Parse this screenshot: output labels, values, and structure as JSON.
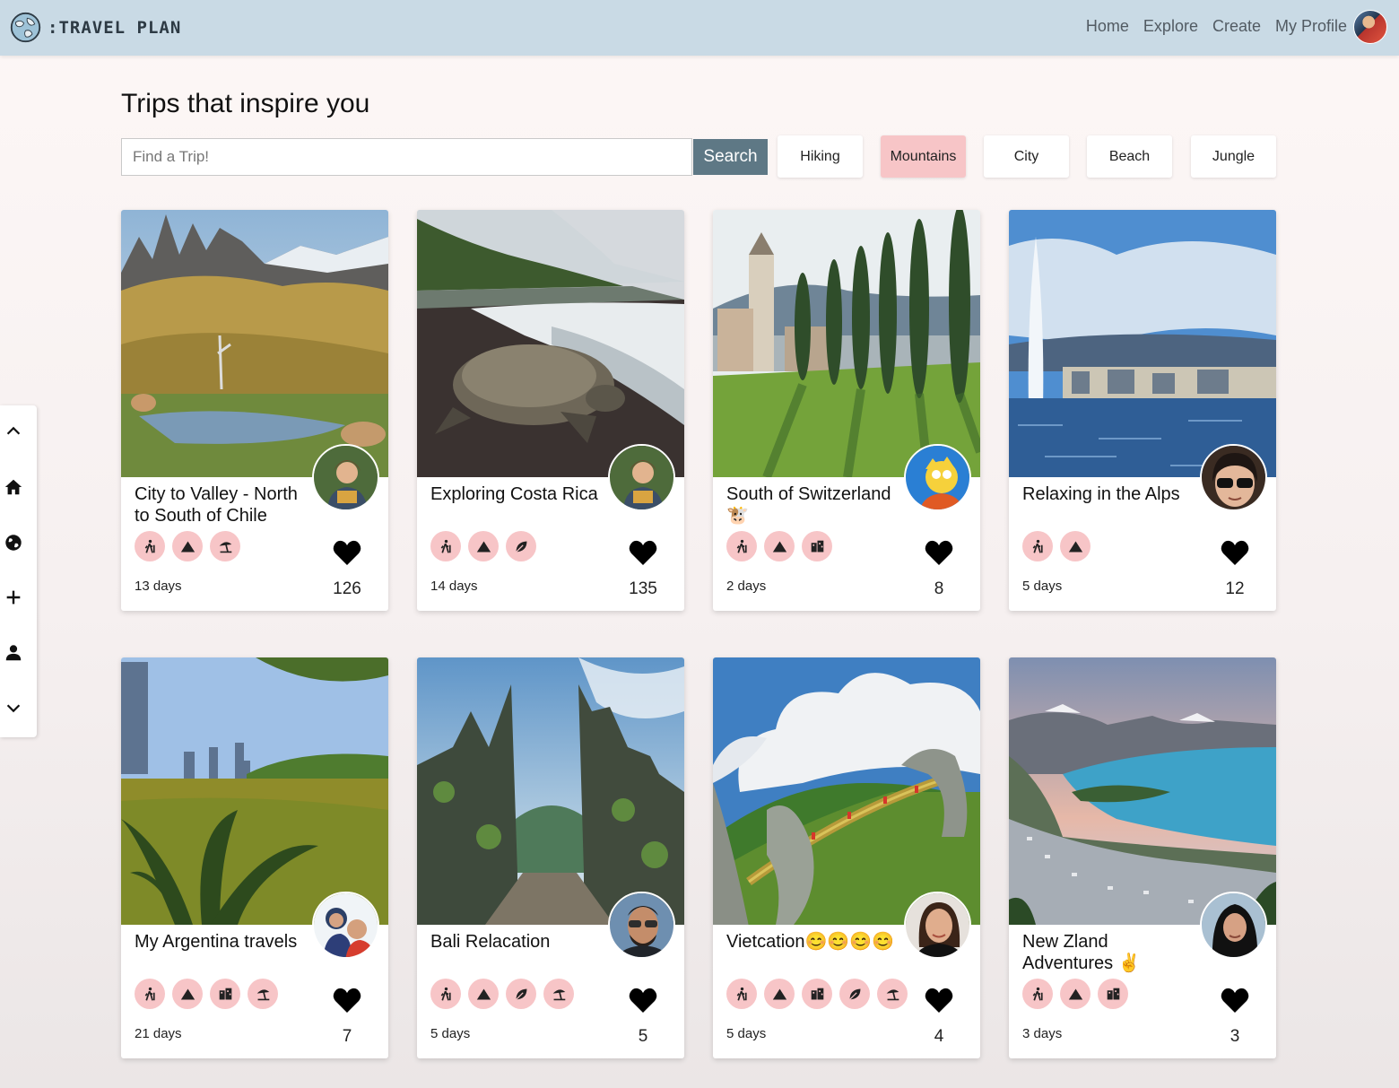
{
  "app": {
    "logo_text": ":TRAVEL PLAN"
  },
  "nav": {
    "links": [
      "Home",
      "Explore",
      "Create",
      "My Profile"
    ]
  },
  "page": {
    "title": "Trips that inspire you"
  },
  "search": {
    "placeholder": "Find a Trip!",
    "button_label": "Search"
  },
  "filters": [
    {
      "label": "Hiking",
      "active": false
    },
    {
      "label": "Mountains",
      "active": true
    },
    {
      "label": "City",
      "active": false
    },
    {
      "label": "Beach",
      "active": false
    },
    {
      "label": "Jungle",
      "active": false
    }
  ],
  "sidebar": {
    "icons": [
      "chevron-up-icon",
      "home-icon",
      "globe-icon",
      "plus-icon",
      "user-icon",
      "chevron-down-icon"
    ]
  },
  "colors": {
    "navbar": "#c9dae5",
    "tag_bg": "#f7c5c7",
    "active_filter": "#f7c5c7",
    "search_button": "#5e7885"
  },
  "trips": [
    {
      "title": "City to Valley - North to South of Chile",
      "days": "13 days",
      "likes": "126",
      "tags": [
        "hiking-icon",
        "mountain-icon",
        "beach-icon"
      ]
    },
    {
      "title": "Exploring Costa Rica",
      "days": "14 days",
      "likes": "135",
      "tags": [
        "hiking-icon",
        "mountain-icon",
        "jungle-icon"
      ]
    },
    {
      "title": "South of Switzerland 🐮",
      "days": "2 days",
      "likes": "8",
      "tags": [
        "hiking-icon",
        "mountain-icon",
        "city-icon"
      ]
    },
    {
      "title": "Relaxing in the Alps",
      "days": "5 days",
      "likes": "12",
      "tags": [
        "hiking-icon",
        "mountain-icon"
      ]
    },
    {
      "title": "My Argentina travels",
      "days": "21 days",
      "likes": "7",
      "tags": [
        "hiking-icon",
        "mountain-icon",
        "city-icon",
        "beach-icon"
      ]
    },
    {
      "title": "Bali Relacation",
      "days": "5 days",
      "likes": "5",
      "tags": [
        "hiking-icon",
        "mountain-icon",
        "jungle-icon",
        "beach-icon"
      ]
    },
    {
      "title": "Vietcation😊😊😊😊",
      "days": "5 days",
      "likes": "4",
      "tags": [
        "hiking-icon",
        "mountain-icon",
        "city-icon",
        "jungle-icon",
        "beach-icon"
      ]
    },
    {
      "title": "New Zland Adventures ✌",
      "days": "3 days",
      "likes": "3",
      "tags": [
        "hiking-icon",
        "mountain-icon",
        "city-icon"
      ]
    }
  ]
}
